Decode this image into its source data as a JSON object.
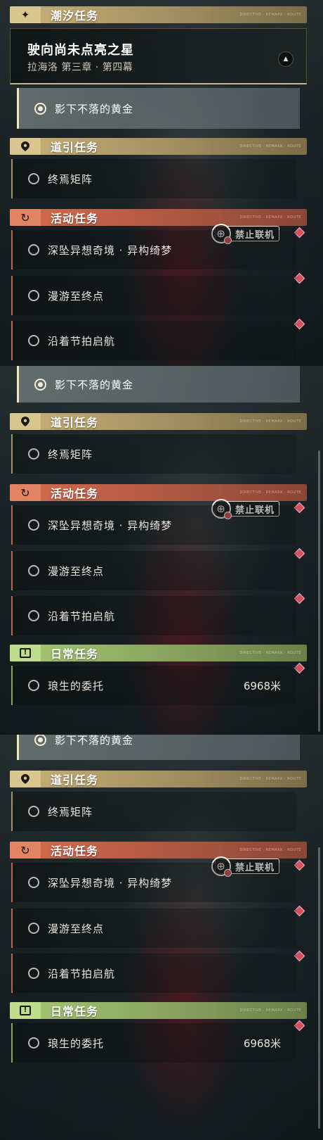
{
  "tidal": {
    "header": "潮汐任务",
    "icon": "sparkle-icon"
  },
  "main_quest": {
    "title": "驶向尚未点亮之星",
    "subtitle": "拉海洛 第三章 · 第四幕",
    "collapse_icon": "chevron-up-icon"
  },
  "selected_quest": {
    "label": "影下不落的黄金"
  },
  "guide": {
    "header": "道引任务",
    "icon": "map-pin-icon",
    "items": [
      {
        "label": "终焉矩阵"
      }
    ]
  },
  "event": {
    "header": "活动任务",
    "icon": "refresh-icon",
    "items": [
      {
        "label": "深坠异想奇境 · 异构绮梦"
      },
      {
        "label": "漫游至终点"
      },
      {
        "label": "沿着节拍启航"
      }
    ],
    "restriction": "禁止联机"
  },
  "daily": {
    "header": "日常任务",
    "icon_text": "!",
    "items": [
      {
        "label": "琅生的委托",
        "distance": "6968米"
      }
    ]
  },
  "header_deco": "DIRECTIVE · REMARK · ROUTE"
}
